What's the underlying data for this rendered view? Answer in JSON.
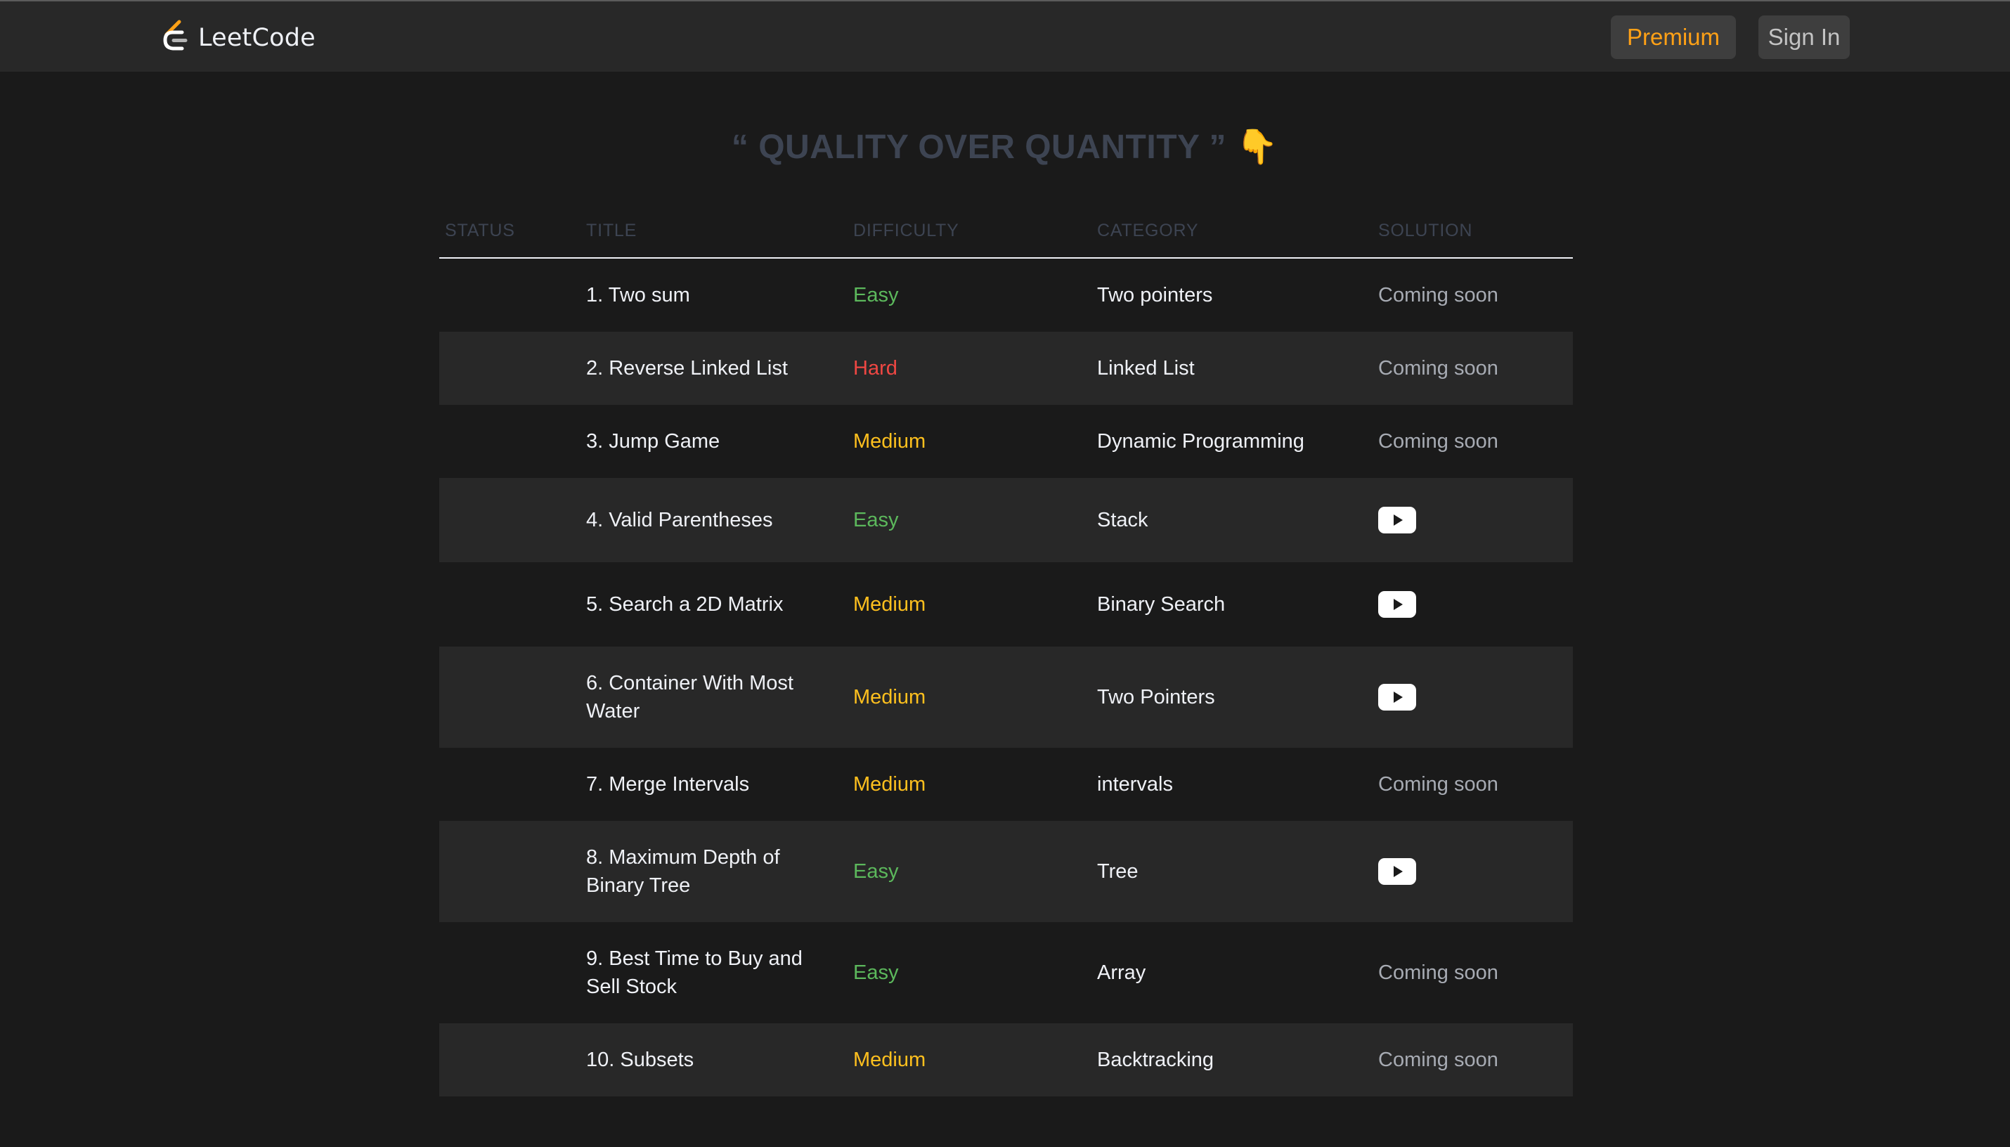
{
  "brand": {
    "name": "LeetCode",
    "logo_icon": "leetcode-logo-icon",
    "logo_colors": [
      "#ffa116",
      "#ffffff",
      "#b3b3b3"
    ]
  },
  "nav": {
    "premium_label": "Premium",
    "signin_label": "Sign In"
  },
  "motto": {
    "text": "“ QUALITY OVER QUANTITY ”",
    "emoji": "👇"
  },
  "table": {
    "headers": {
      "status": "STATUS",
      "title": "TITLE",
      "difficulty": "DIFFICULTY",
      "category": "CATEGORY",
      "solution": "SOLUTION"
    },
    "rows": [
      {
        "status": "",
        "title": "1. Two sum",
        "difficulty": "Easy",
        "category": "Two pointers",
        "solution": "Coming soon",
        "has_video": false
      },
      {
        "status": "",
        "title": "2. Reverse Linked List",
        "difficulty": "Hard",
        "category": "Linked List",
        "solution": "Coming soon",
        "has_video": false
      },
      {
        "status": "",
        "title": "3. Jump Game",
        "difficulty": "Medium",
        "category": "Dynamic Programming",
        "solution": "Coming soon",
        "has_video": false
      },
      {
        "status": "",
        "title": "4. Valid Parentheses",
        "difficulty": "Easy",
        "category": "Stack",
        "solution": "",
        "has_video": true
      },
      {
        "status": "",
        "title": "5. Search a 2D Matrix",
        "difficulty": "Medium",
        "category": "Binary Search",
        "solution": "",
        "has_video": true
      },
      {
        "status": "",
        "title": "6. Container With Most Water",
        "difficulty": "Medium",
        "category": "Two Pointers",
        "solution": "",
        "has_video": true
      },
      {
        "status": "",
        "title": "7. Merge Intervals",
        "difficulty": "Medium",
        "category": "intervals",
        "solution": "Coming soon",
        "has_video": false
      },
      {
        "status": "",
        "title": "8. Maximum Depth of Binary Tree",
        "difficulty": "Easy",
        "category": "Tree",
        "solution": "",
        "has_video": true
      },
      {
        "status": "",
        "title": "9. Best Time to Buy and Sell Stock",
        "difficulty": "Easy",
        "category": "Array",
        "solution": "Coming soon",
        "has_video": false
      },
      {
        "status": "",
        "title": "10. Subsets",
        "difficulty": "Medium",
        "category": "Backtracking",
        "solution": "Coming soon",
        "has_video": false
      }
    ]
  },
  "icons": {
    "video": "youtube-play-icon"
  },
  "colors": {
    "background": "#1a1a1a",
    "surface": "#282828",
    "accent": "#ffa116",
    "easy": "#5cb85c",
    "medium": "#ffc01e",
    "hard": "#ef4743",
    "muted_heading": "#3d4452"
  }
}
